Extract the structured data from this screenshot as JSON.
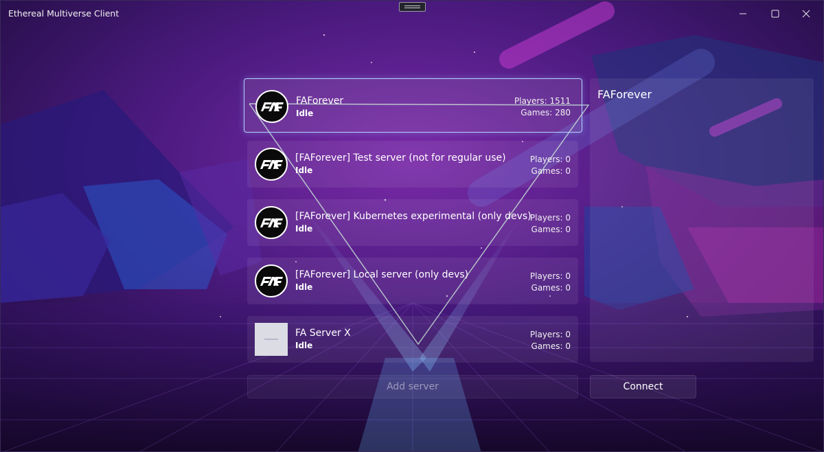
{
  "window": {
    "title": "Ethereal Multiverse Client"
  },
  "servers": [
    {
      "name": "FAForever",
      "status": "Idle",
      "players": "Players: 1511",
      "games": "Games: 280",
      "icon": "faf-logo-icon",
      "selected": true
    },
    {
      "name": "[FAForever] Test server (not for regular use)",
      "status": "Idle",
      "players": "Players: 0",
      "games": "Games: 0",
      "icon": "faf-logo-icon"
    },
    {
      "name": "[FAForever] Kubernetes experimental (only devs)",
      "status": "Idle",
      "players": "Players: 0",
      "games": "Games: 0",
      "icon": "faf-logo-icon"
    },
    {
      "name": "[FAForever] Local server (only devs)",
      "status": "Idle",
      "players": "Players: 0",
      "games": "Games: 0",
      "icon": "faf-logo-icon"
    },
    {
      "name": "FA Server X",
      "status": "Idle",
      "players": "Players: 0",
      "games": "Games: 0",
      "icon": "placeholder-image-icon"
    }
  ],
  "detail": {
    "title": "FAForever"
  },
  "actions": {
    "add_server": "Add server",
    "connect": "Connect"
  },
  "colors": {
    "selection_border": "#b6d2ff",
    "background_dark": "#1a0b35",
    "background_purple": "#6a1f9c",
    "background_blue": "#1e3a8a"
  }
}
